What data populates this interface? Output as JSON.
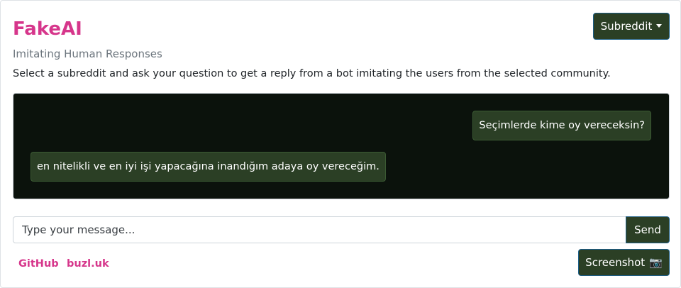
{
  "header": {
    "title": "FakeAI",
    "subtitle": "Imitating Human Responses",
    "description": "Select a subreddit and ask your question to get a reply from a bot imitating the users from the selected community."
  },
  "subreddit_dropdown": {
    "label": "Subreddit",
    "icon": "caret-down-icon"
  },
  "chat": {
    "messages": [
      {
        "role": "user",
        "text": "Seçimlerde kime oy vereceksin?"
      },
      {
        "role": "bot",
        "text": "en nitelikli ve en iyi işi yapacağına inandığım adaya oy vereceğim."
      }
    ]
  },
  "composer": {
    "placeholder": "Type your message...",
    "value": "",
    "send_label": "Send"
  },
  "footer": {
    "links": [
      {
        "label": "GitHub"
      },
      {
        "label": "buzl.uk"
      }
    ],
    "screenshot_label": "Screenshot",
    "screenshot_icon": "📷"
  },
  "colors": {
    "accent": "#d6368b",
    "button_bg": "#2b3f25",
    "chat_bg": "#0b120c",
    "muted": "#6c757d"
  }
}
